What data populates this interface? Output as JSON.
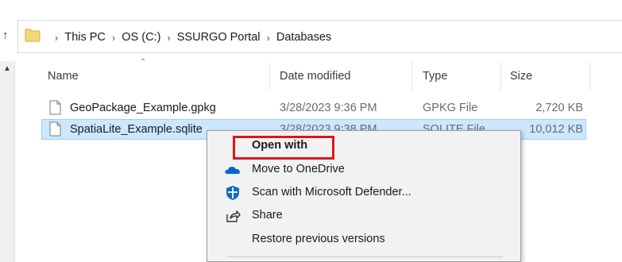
{
  "breadcrumb": {
    "items": [
      "This PC",
      "OS (C:)",
      "SSURGO Portal",
      "Databases"
    ],
    "separator": "›"
  },
  "columns": {
    "name": "Name",
    "date_modified": "Date modified",
    "type": "Type",
    "size": "Size"
  },
  "files": [
    {
      "name": "GeoPackage_Example.gpkg",
      "date_modified": "3/28/2023 9:36 PM",
      "type": "GPKG File",
      "size": "2,720 KB",
      "selected": false
    },
    {
      "name": "SpatiaLite_Example.sqlite",
      "date_modified": "3/28/2023 9:38 PM",
      "type": "SQLITE File",
      "size": "10,012 KB",
      "selected": true
    }
  ],
  "context_menu": {
    "items": [
      {
        "label": "Open with",
        "icon": "none",
        "bold": true,
        "highlighted": true
      },
      {
        "label": "Move to OneDrive",
        "icon": "onedrive-cloud-icon"
      },
      {
        "label": "Scan with Microsoft Defender...",
        "icon": "defender-shield-icon"
      },
      {
        "label": "Share",
        "icon": "share-icon"
      },
      {
        "label": "Restore previous versions",
        "icon": "none"
      }
    ]
  },
  "colors": {
    "selection_bg": "#cce8ff",
    "selection_border": "#99d1ff",
    "highlight_border": "#e0141b",
    "onedrive_blue": "#0a64c8",
    "defender_blue": "#0f6cbd",
    "folder_yellow": "#f8d775"
  }
}
